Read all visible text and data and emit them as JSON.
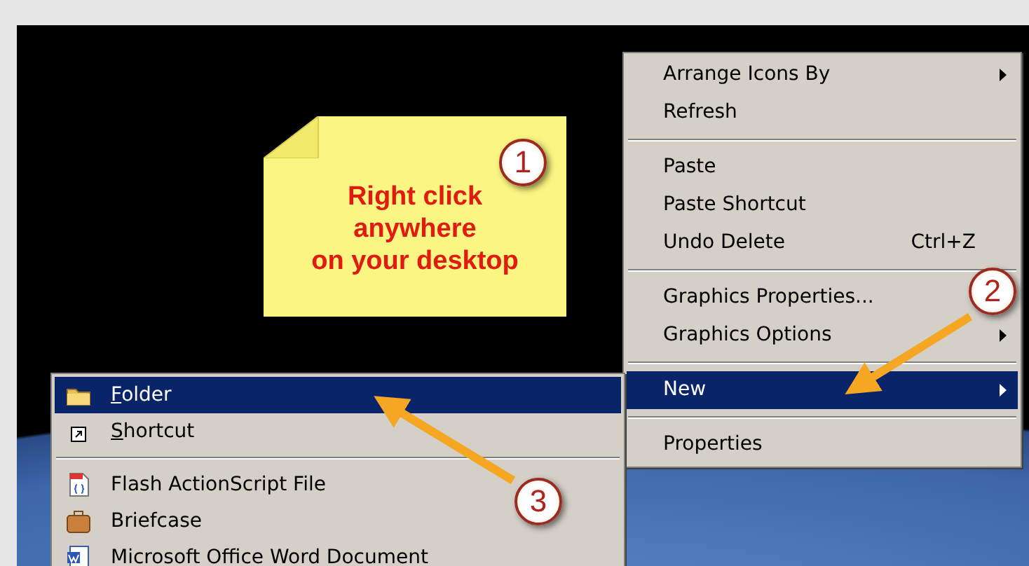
{
  "note": {
    "text": "Right click\nanywhere\non your desktop"
  },
  "context_menu": {
    "items": [
      {
        "kind": "item",
        "label": "Arrange Icons By",
        "has_submenu": true,
        "selected": false
      },
      {
        "kind": "item",
        "label": "Refresh",
        "has_submenu": false,
        "selected": false
      },
      {
        "kind": "separator"
      },
      {
        "kind": "item",
        "label": "Paste",
        "has_submenu": false,
        "selected": false
      },
      {
        "kind": "item",
        "label": "Paste Shortcut",
        "has_submenu": false,
        "selected": false
      },
      {
        "kind": "item",
        "label": "Undo Delete",
        "shortcut": "Ctrl+Z",
        "has_submenu": false,
        "selected": false
      },
      {
        "kind": "separator"
      },
      {
        "kind": "item",
        "label": "Graphics Properties...",
        "has_submenu": false,
        "selected": false
      },
      {
        "kind": "item",
        "label": "Graphics Options",
        "has_submenu": true,
        "selected": false
      },
      {
        "kind": "separator"
      },
      {
        "kind": "item",
        "label": "New",
        "has_submenu": true,
        "selected": true
      },
      {
        "kind": "separator"
      },
      {
        "kind": "item",
        "label": "Properties",
        "has_submenu": false,
        "selected": false
      }
    ]
  },
  "submenu": {
    "items": [
      {
        "kind": "item",
        "label": "Folder",
        "underline_first": true,
        "selected": true
      },
      {
        "kind": "item",
        "label": "Shortcut",
        "underline_first": true,
        "selected": false
      },
      {
        "kind": "separator"
      },
      {
        "kind": "item",
        "label": "Flash ActionScript File",
        "underline_first": false,
        "selected": false
      },
      {
        "kind": "item",
        "label": "Briefcase",
        "underline_first": false,
        "selected": false
      },
      {
        "kind": "item",
        "label": "Microsoft Office Word Document",
        "underline_first": false,
        "selected": false
      }
    ]
  },
  "steps": [
    {
      "number": "1"
    },
    {
      "number": "2"
    },
    {
      "number": "3"
    }
  ]
}
